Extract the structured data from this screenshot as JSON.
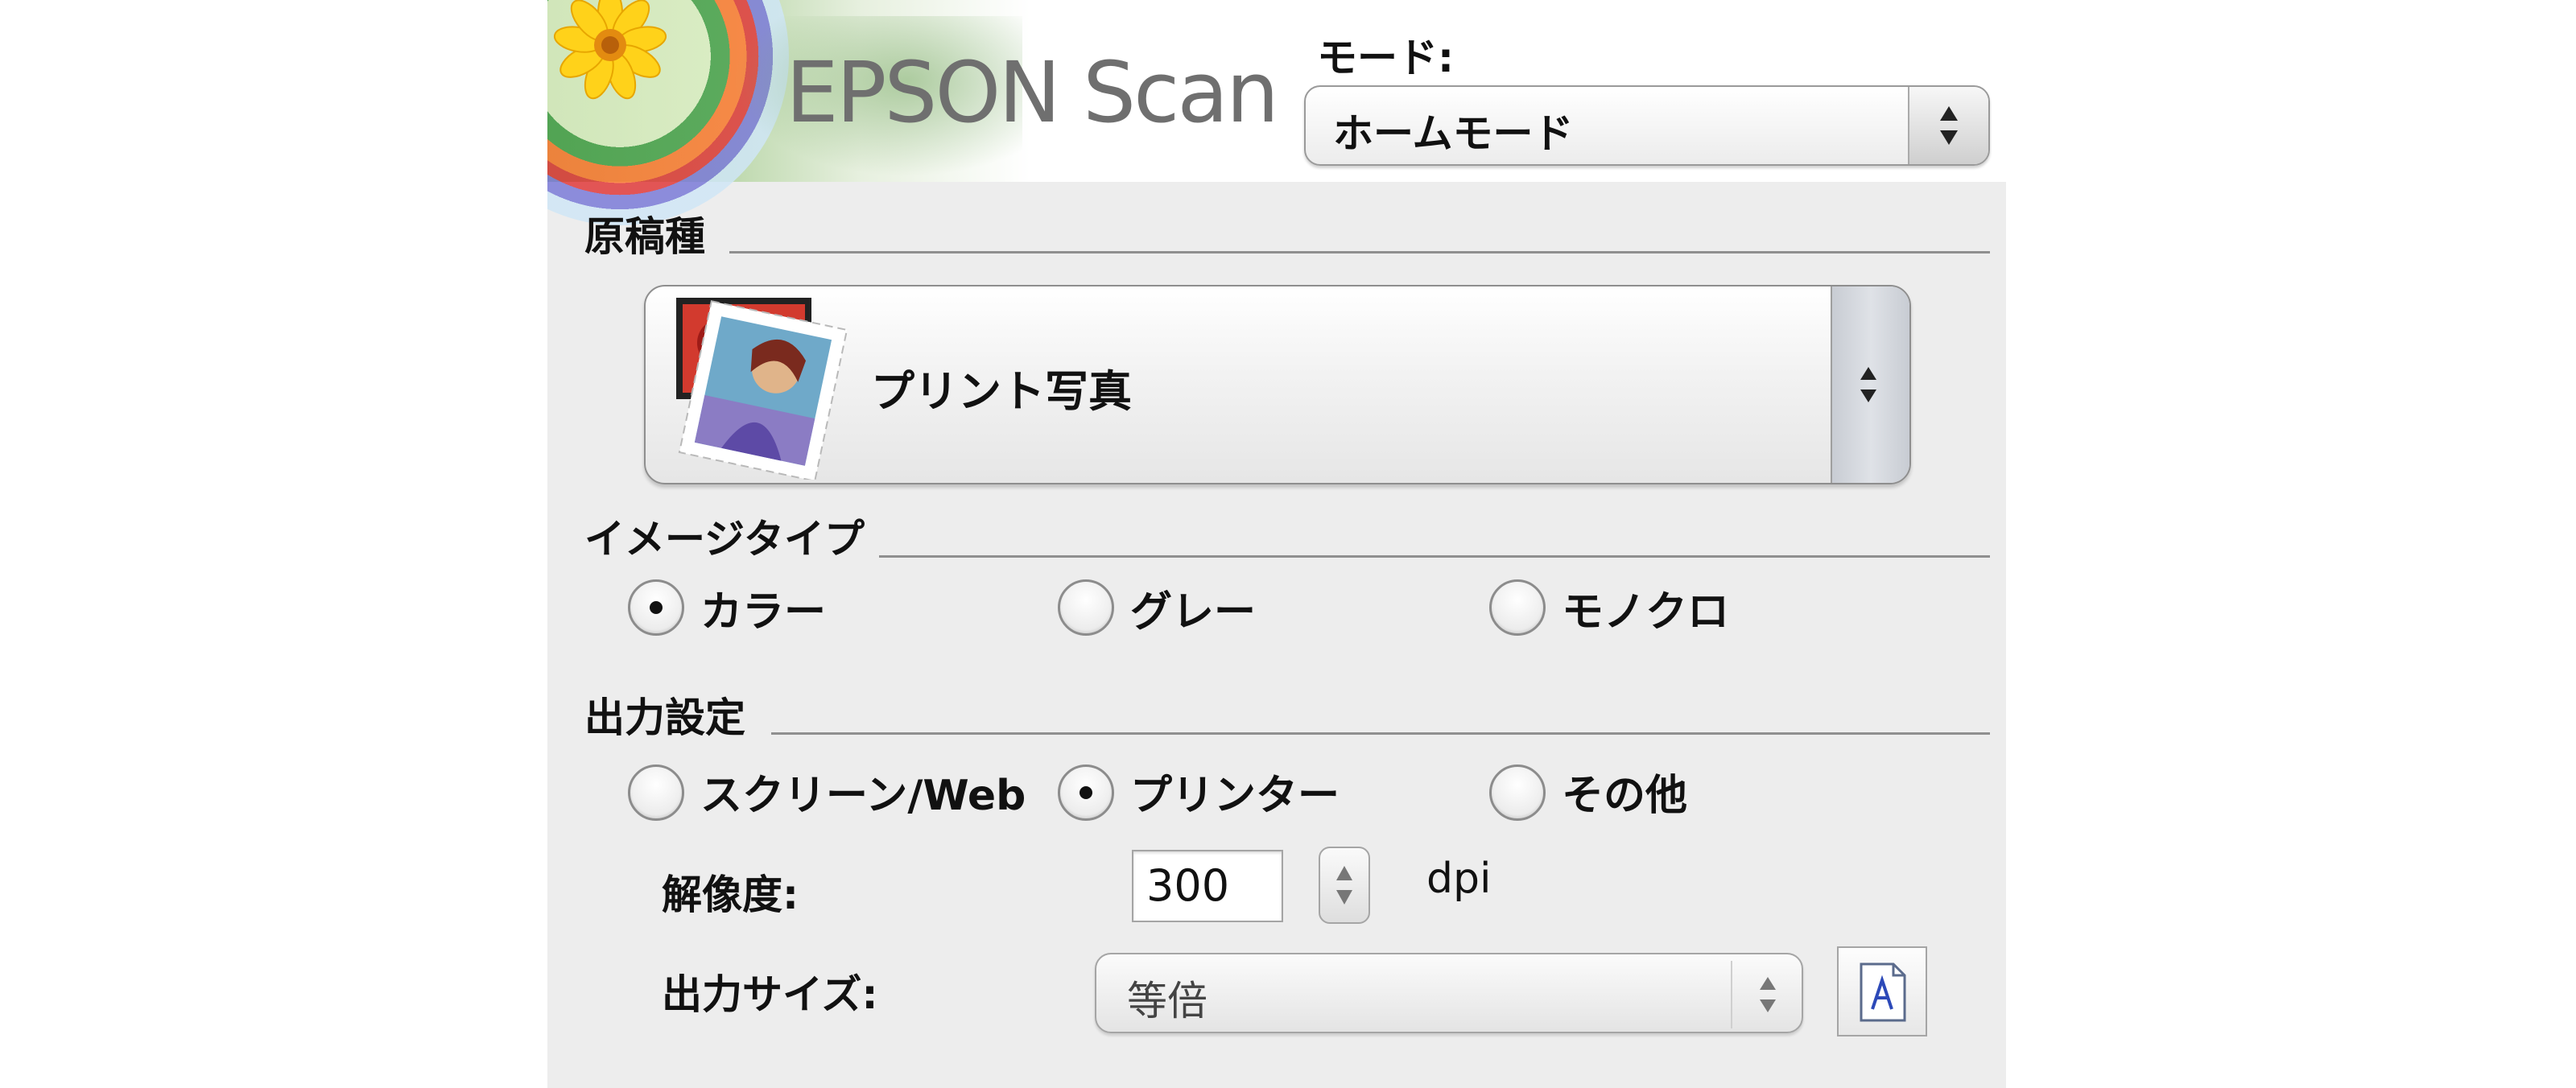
{
  "app": {
    "title": "EPSON Scan"
  },
  "mode": {
    "label": "モード:",
    "selected": "ホームモード"
  },
  "document_type": {
    "section_title": "原稿種",
    "selected": "プリント写真"
  },
  "image_type": {
    "section_title": "イメージタイプ",
    "options": [
      "カラー",
      "グレー",
      "モノクロ"
    ],
    "selected": "カラー"
  },
  "output": {
    "section_title": "出力設定",
    "options": [
      "スクリーン/Web",
      "プリンター",
      "その他"
    ],
    "selected": "プリンター",
    "resolution_label": "解像度:",
    "resolution_value": "300",
    "resolution_unit": "dpi",
    "size_label": "出力サイズ:",
    "size_value": "等倍"
  }
}
